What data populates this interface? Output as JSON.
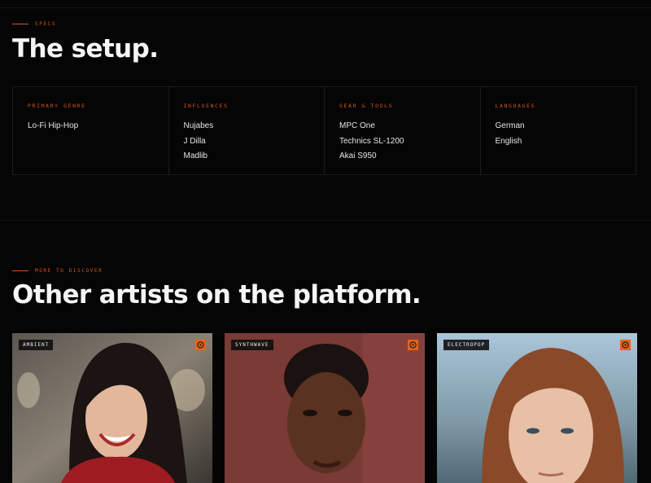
{
  "specs_section": {
    "eyebrow": "SPECS",
    "title": "The setup.",
    "columns": [
      {
        "label": "PRIMARY GENRE",
        "items": [
          "Lo-Fi Hip-Hop"
        ]
      },
      {
        "label": "INFLUENCES",
        "items": [
          "Nujabes",
          "J Dilla",
          "Madlib"
        ]
      },
      {
        "label": "GEAR & TOOLS",
        "items": [
          "MPC One",
          "Technics SL-1200",
          "Akai S950"
        ]
      },
      {
        "label": "LANGUAGES",
        "items": [
          "German",
          "English"
        ]
      }
    ]
  },
  "discover_section": {
    "eyebrow": "MORE TO DISCOVER",
    "title": "Other artists on the platform.",
    "cards": [
      {
        "tag": "AMBIENT",
        "badge_icon": "record-icon"
      },
      {
        "tag": "SYNTHWAVE",
        "badge_icon": "record-icon"
      },
      {
        "tag": "ELECTROPOP",
        "badge_icon": "record-icon"
      }
    ]
  },
  "colors": {
    "accent": "#d4561e",
    "badge": "#e8631a",
    "background": "#050505"
  }
}
